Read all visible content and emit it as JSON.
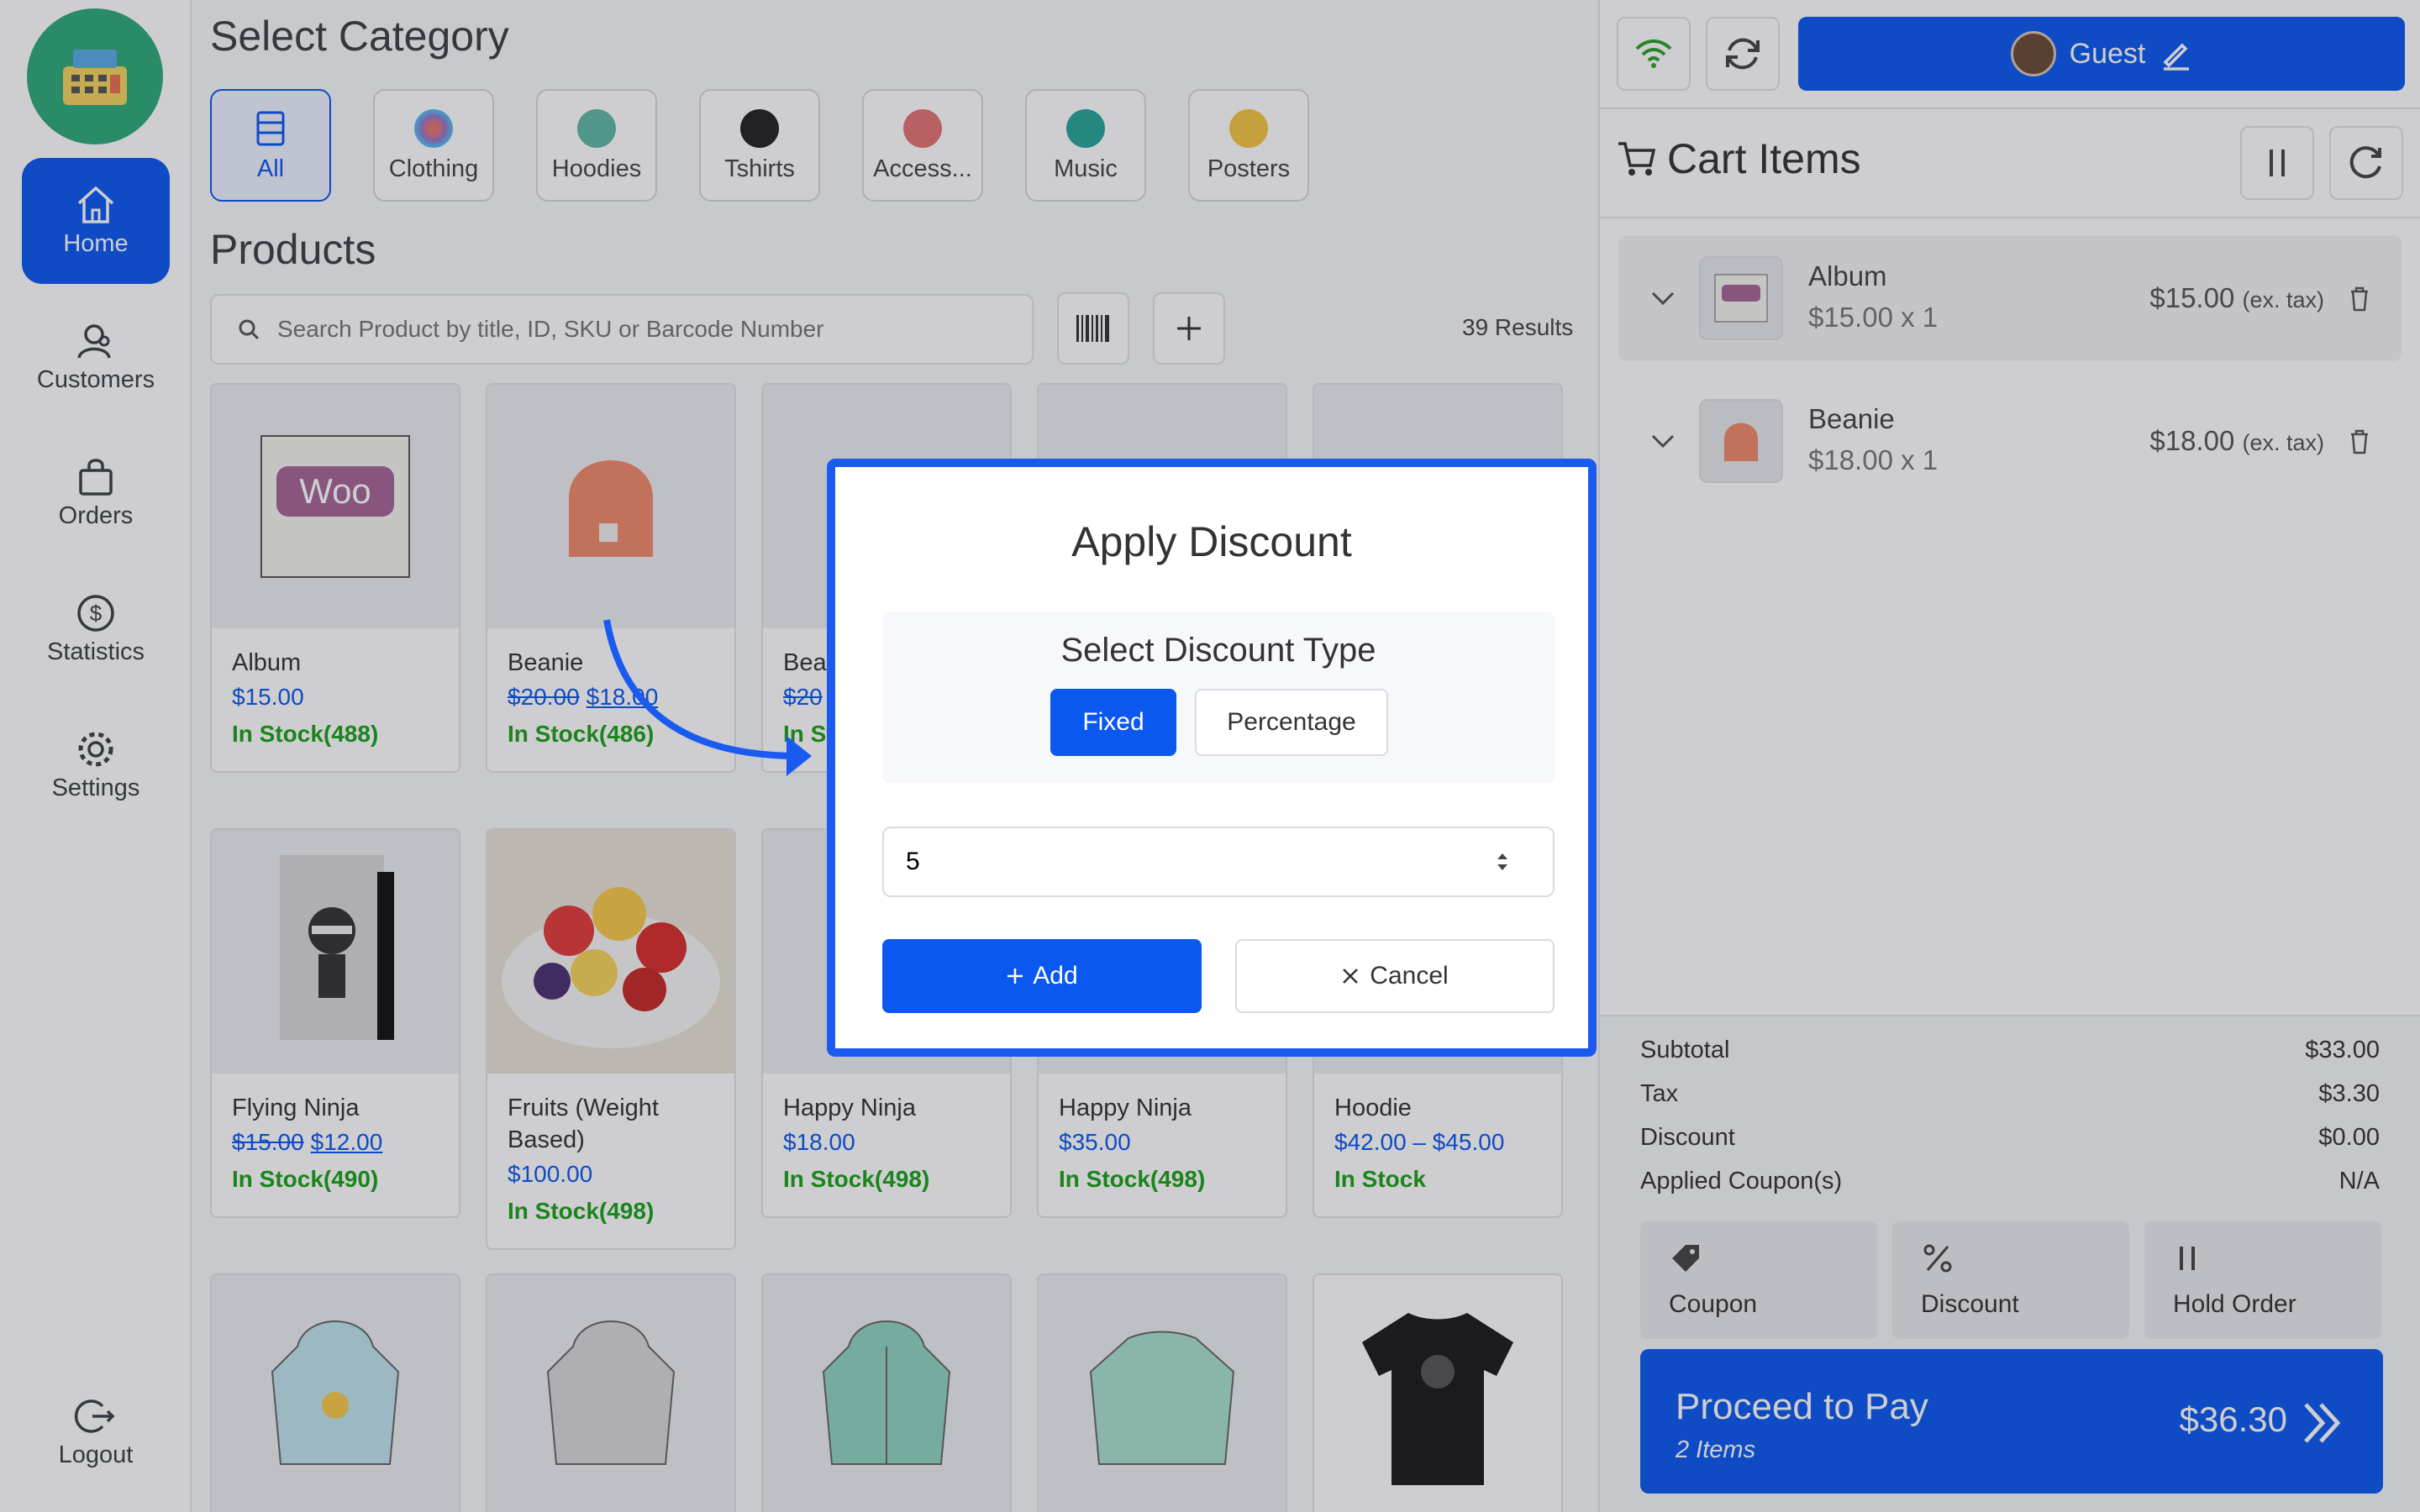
{
  "sidebar": {
    "items": [
      {
        "label": "Home",
        "icon": "home-icon",
        "active": true
      },
      {
        "label": "Customers",
        "icon": "customers-icon"
      },
      {
        "label": "Orders",
        "icon": "orders-icon"
      },
      {
        "label": "Statistics",
        "icon": "statistics-icon"
      },
      {
        "label": "Settings",
        "icon": "gear-icon"
      }
    ],
    "logout": "Logout"
  },
  "main": {
    "category_heading": "Select Category",
    "categories": [
      {
        "label": "All",
        "active": true
      },
      {
        "label": "Clothing"
      },
      {
        "label": "Hoodies"
      },
      {
        "label": "Tshirts"
      },
      {
        "label": "Access..."
      },
      {
        "label": "Music"
      },
      {
        "label": "Posters"
      }
    ],
    "products_heading": "Products",
    "search_placeholder": "Search Product by title, ID, SKU or Barcode Number",
    "results": "39 Results",
    "products": [
      {
        "title": "Album",
        "price": "$15.00",
        "old_price": "",
        "stock": "In Stock(488)"
      },
      {
        "title": "Beanie",
        "old_price": "$20.00",
        "price": "$18.00",
        "stock": "In Stock(486)"
      },
      {
        "title": "Bear",
        "old_price": "$20",
        "price": "",
        "stock": "In St"
      },
      {
        "title": "",
        "price": "",
        "stock": ""
      },
      {
        "title": "",
        "price": "",
        "stock": ""
      },
      {
        "title": "Flying Ninja",
        "old_price": "$15.00",
        "price": "$12.00",
        "stock": "In Stock(490)"
      },
      {
        "title": "Fruits (Weight Based)",
        "old_price": "",
        "price": "$100.00",
        "stock": "In Stock(498)"
      },
      {
        "title": "Happy Ninja",
        "old_price": "",
        "price": "$18.00",
        "stock": "In Stock(498)"
      },
      {
        "title": "Happy Ninja",
        "old_price": "",
        "price": "$35.00",
        "stock": "In Stock(498)"
      },
      {
        "title": "Hoodie",
        "old_price": "",
        "price": "$42.00 – $45.00",
        "stock": "In Stock"
      }
    ]
  },
  "cart": {
    "guest_label": "Guest",
    "heading": "Cart Items",
    "items": [
      {
        "name": "Album",
        "qty": "$15.00 x 1",
        "amount": "$15.00",
        "tax_note": "(ex. tax)"
      },
      {
        "name": "Beanie",
        "qty": "$18.00 x 1",
        "amount": "$18.00",
        "tax_note": "(ex. tax)"
      }
    ],
    "summary": {
      "subtotal_label": "Subtotal",
      "subtotal": "$33.00",
      "tax_label": "Tax",
      "tax": "$3.30",
      "discount_label": "Discount",
      "discount": "$0.00",
      "coupons_label": "Applied Coupon(s)",
      "coupons": "N/A"
    },
    "actions": {
      "coupon": "Coupon",
      "discount": "Discount",
      "hold": "Hold Order"
    },
    "pay": {
      "label": "Proceed to Pay",
      "items": "2 Items",
      "total": "$36.30"
    }
  },
  "modal": {
    "title": "Apply Discount",
    "type_label": "Select Discount Type",
    "fixed": "Fixed",
    "percentage": "Percentage",
    "value": "5",
    "add": "Add",
    "cancel": "Cancel"
  },
  "colors": {
    "accent": "#0a58f0",
    "stock": "#1aa01a",
    "highlight": "#1a5af0"
  }
}
